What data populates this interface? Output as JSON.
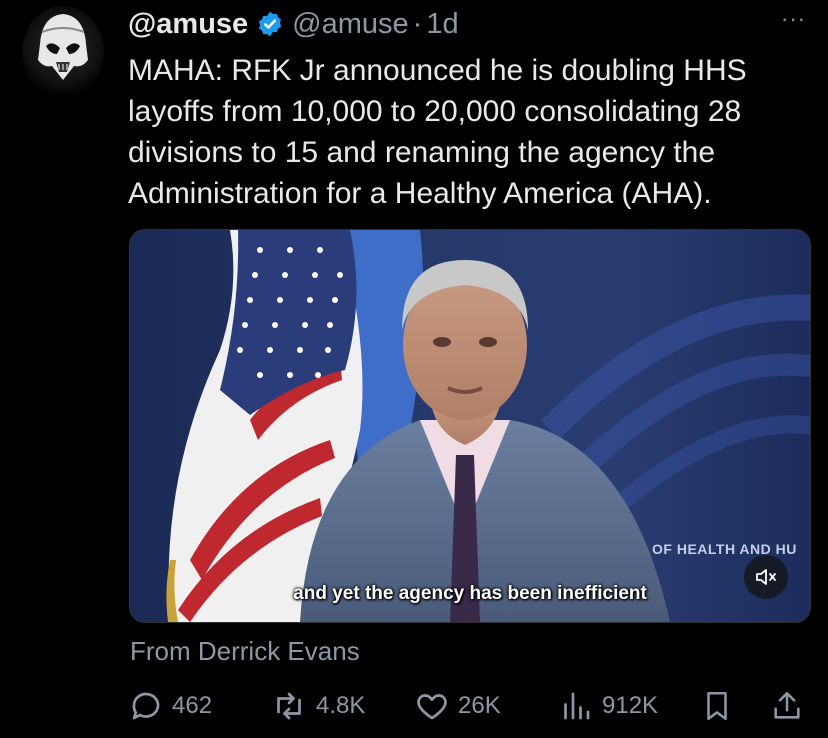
{
  "post": {
    "display_name": "@amuse",
    "handle": "@amuse",
    "separator": "·",
    "time": "1d",
    "more_label": "···",
    "text": "MAHA: RFK Jr announced he is doubling HHS layoffs from 10,000 to 20,000 consolidating 28 divisions to 15 and renaming the agency the Administration for a Healthy America (AHA).",
    "attribution": "From Derrick Evans"
  },
  "media": {
    "subtitle": "and yet the agency has been inefficient",
    "background_text": "OF HEALTH AND HU"
  },
  "actions": {
    "replies": "462",
    "reposts": "4.8K",
    "likes": "26K",
    "views": "912K"
  },
  "colors": {
    "background": "#000000",
    "text": "#e7e9ea",
    "muted": "#8b98a5",
    "verified": "#1d9bf0",
    "border": "#2f3336"
  },
  "icons": [
    "stormtrooper-avatar",
    "verified-badge-icon",
    "more-icon",
    "mute-icon",
    "reply-icon",
    "repost-icon",
    "like-icon",
    "views-icon",
    "bookmark-icon",
    "share-icon"
  ]
}
